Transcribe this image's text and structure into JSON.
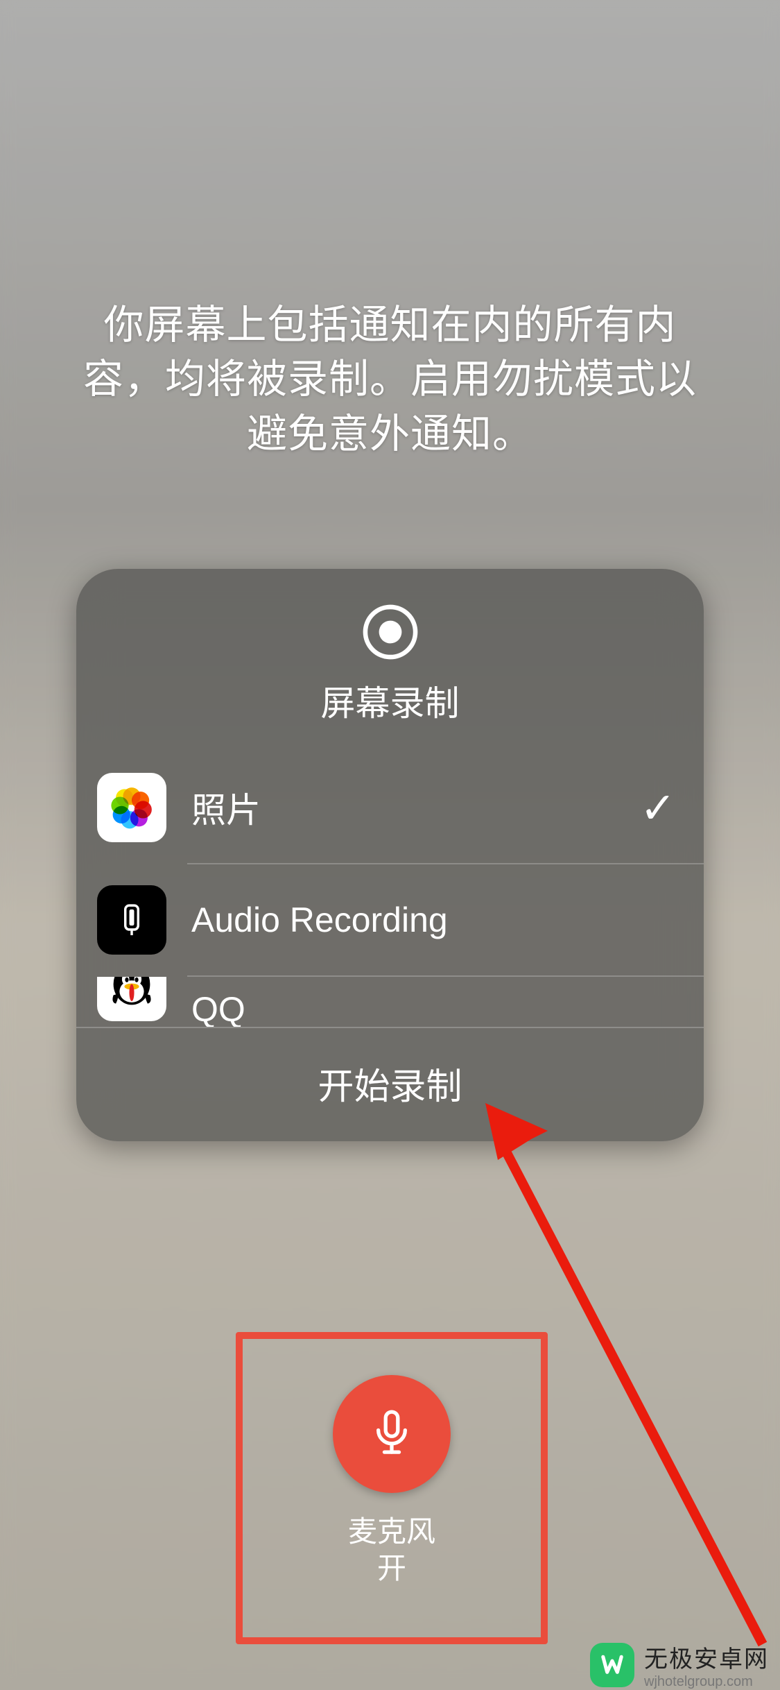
{
  "notice_text": "你屏幕上包括通知在内的所有内容，均将被录制。启用勿扰模式以避免意外通知。",
  "panel": {
    "title": "屏幕录制",
    "options": [
      {
        "label": "照片",
        "selected": true,
        "icon": "photos"
      },
      {
        "label": "Audio Recording",
        "selected": false,
        "icon": "audio"
      },
      {
        "label": "QQ",
        "selected": false,
        "icon": "qq"
      }
    ],
    "start_label": "开始录制"
  },
  "mic": {
    "label": "麦克风",
    "state": "开",
    "on": true
  },
  "watermark": {
    "title": "无极安卓网",
    "sub": "wjhotelgroup.com"
  }
}
